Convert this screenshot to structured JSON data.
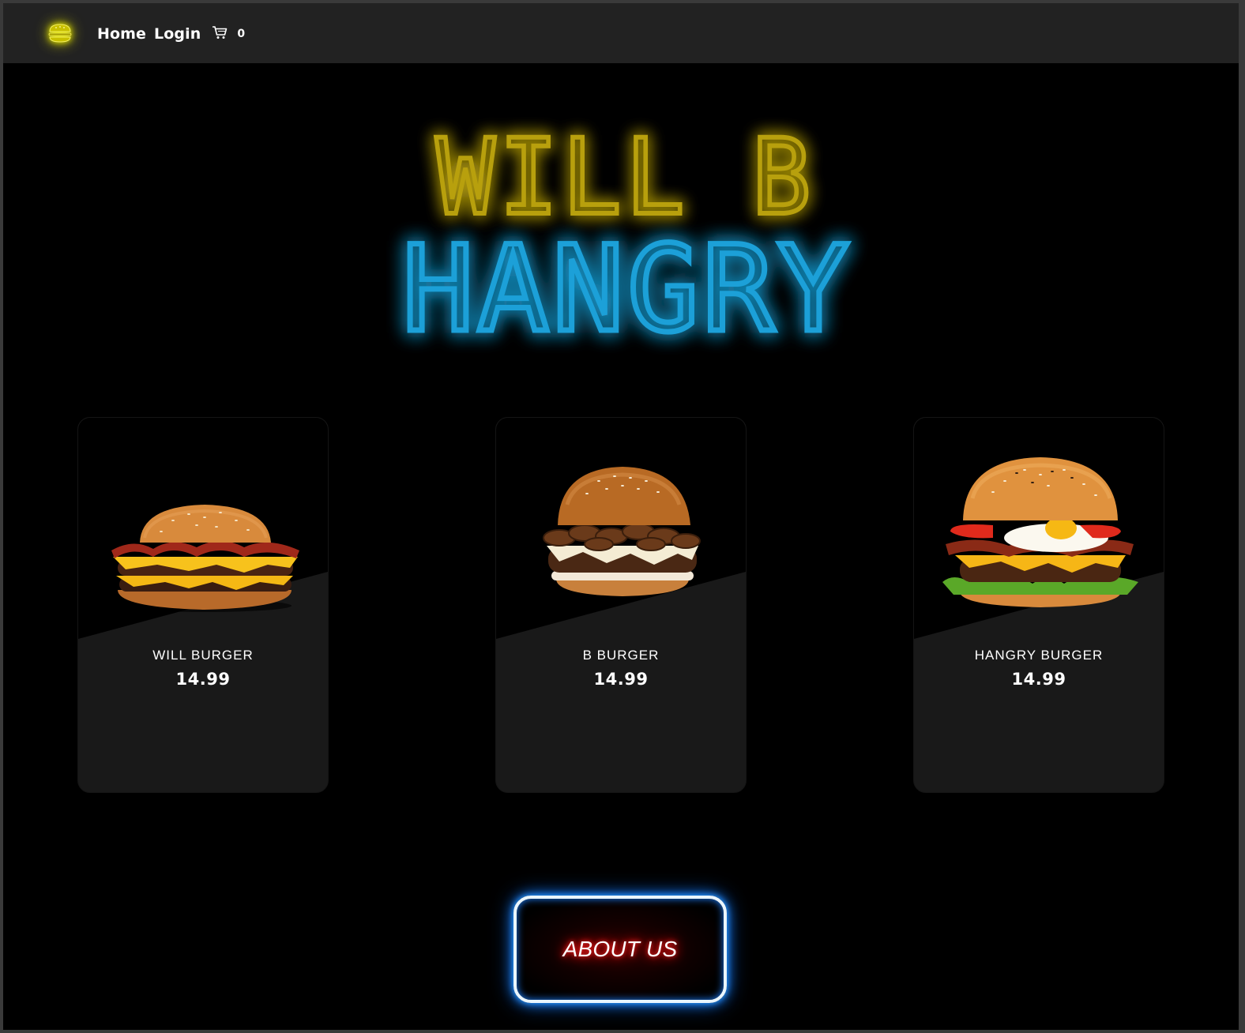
{
  "navbar": {
    "logo_icon": "burger-icon",
    "links": [
      {
        "label": "Home"
      },
      {
        "label": "Login"
      }
    ],
    "cart_icon": "cart-icon",
    "cart_count": "0"
  },
  "hero": {
    "line1": "WILL B",
    "line2": "HANGRY",
    "colors": {
      "line1_fill": "#b8a010",
      "line1_glow": "#ff2a00",
      "line2_fill": "#1aa0d8",
      "line2_glow": "#0060ff"
    }
  },
  "menu": {
    "items": [
      {
        "name": "WILL BURGER",
        "price": "14.99",
        "image": "burger-bacon-cheese-image"
      },
      {
        "name": "B BURGER",
        "price": "14.99",
        "image": "burger-mushroom-swiss-image"
      },
      {
        "name": "HANGRY BURGER",
        "price": "14.99",
        "image": "burger-egg-bacon-image"
      }
    ]
  },
  "about": {
    "label": "ABOUT US",
    "border_color": "#2a9cff",
    "text_glow": "#ff0000"
  },
  "colors": {
    "background": "#000000",
    "navbar": "#222222",
    "card": "#191919",
    "logo_glow": "#e8e800"
  }
}
